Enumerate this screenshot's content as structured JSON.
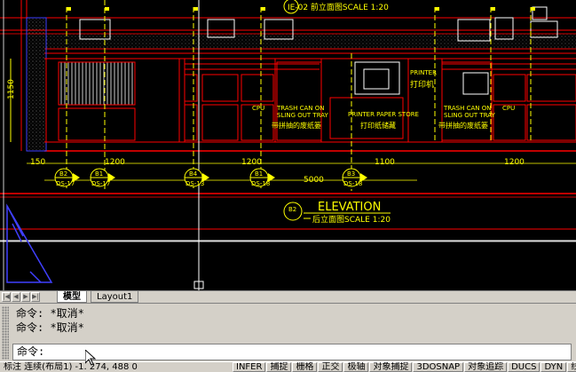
{
  "drawing": {
    "top_title": "IE-02 前立面图SCALE  1:20",
    "dim_height": "1150",
    "labels": {
      "printer_en": "PRINTER",
      "printer_cn": "打印机",
      "cpu_1": "CPU",
      "cpu_2": "CPU",
      "trash_1_en_1": "TRASH CAN ON",
      "trash_1_en_2": "SLING OUT TRAY",
      "trash_1_cn": "带拼抽的废纸篓",
      "paper_store_en": "PRINTER PAPER STORE",
      "paper_store_cn": "打印纸储藏",
      "trash_2_en_1": "TRASH CAN ON",
      "trash_2_en_2": "SLING OUT TRAY",
      "trash_2_cn": "带拼抽的废纸篓"
    },
    "dims": [
      "150",
      "1200",
      "1200",
      "1100",
      "1200",
      "5000"
    ],
    "markers": [
      {
        "num": "B2",
        "ref": "DS-17"
      },
      {
        "num": "B1",
        "ref": "DS-17"
      },
      {
        "num": "B4",
        "ref": "DS-13"
      },
      {
        "num": "B1",
        "ref": "DS-18"
      },
      {
        "num": "B3",
        "ref": "DS-18"
      }
    ],
    "elevation_title": "ELEVATION",
    "elevation_num": "B2",
    "elevation_subtitle": "后立面图SCALE  1:20"
  },
  "tabs": {
    "model": "模型",
    "layout1": "Layout1"
  },
  "command": {
    "history": [
      "命令: *取消*",
      "命令: *取消*"
    ],
    "prompt": "命令:"
  },
  "status": {
    "coords": "标注 连续(布局1)  -1. 274, 488 0",
    "toggles": [
      "INFER",
      "捕捉",
      "栅格",
      "正交",
      "极轴",
      "对象捕捉",
      "3DOSNAP",
      "对象追踪",
      "DUCS",
      "DYN",
      "线宽"
    ]
  }
}
